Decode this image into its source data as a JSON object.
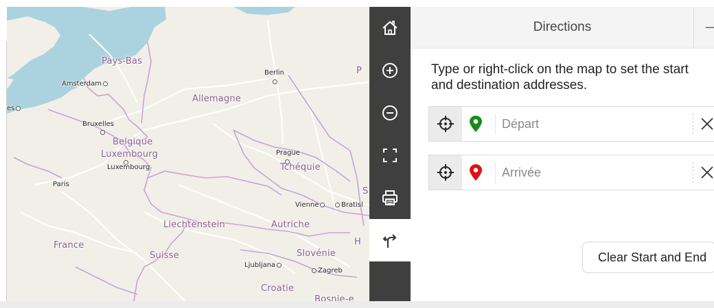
{
  "map": {
    "labels": {
      "pays_bas": "Pays-Bas",
      "allemagne": "Allemagne",
      "belgique": "Belgique",
      "luxembourg_country": "Luxembourg",
      "tchequie": "Tchéquie",
      "liechtenstein": "Liechtenstein",
      "autriche": "Autriche",
      "france": "France",
      "suisse": "Suisse",
      "slovenie": "Slovénie",
      "croatie": "Croatie",
      "bosnie": "Bosnie-e",
      "amsterdam": "Amsterdam",
      "berlin": "Berlin",
      "bruxelles": "Bruxelles",
      "luxembourg_city": "Luxembourg",
      "prague": "Prague",
      "paris": "Paris",
      "vienne": "Vienne",
      "bratislava": "Bratisl",
      "ljubljana": "Ljubljana",
      "zagreb": "Zagreb",
      "edge_es": "es",
      "edge_p": "P",
      "edge_s": "S",
      "edge_h": "H"
    },
    "colors": {
      "land": "#f2efe9",
      "sea": "#aad3df",
      "border": "#c8a3d0",
      "road": "#ffffff"
    }
  },
  "toolbar": {
    "items": [
      {
        "name": "home",
        "icon": "home-icon"
      },
      {
        "name": "zoom-in",
        "icon": "zoom-in-icon"
      },
      {
        "name": "zoom-out",
        "icon": "zoom-out-icon"
      },
      {
        "name": "fullscreen",
        "icon": "fullscreen-icon"
      },
      {
        "name": "print",
        "icon": "print-icon"
      },
      {
        "name": "directions",
        "icon": "directions-icon",
        "active": true
      }
    ]
  },
  "panel": {
    "title": "Directions",
    "collapse_glyph": "–",
    "instructions": "Type or right-click on the map to set the start and destination addresses.",
    "start": {
      "placeholder": "Départ",
      "pin_color": "#1a8a1a"
    },
    "end": {
      "placeholder": "Arrivée",
      "pin_color": "#e01010"
    },
    "clear_label": "Clear Start and End"
  }
}
